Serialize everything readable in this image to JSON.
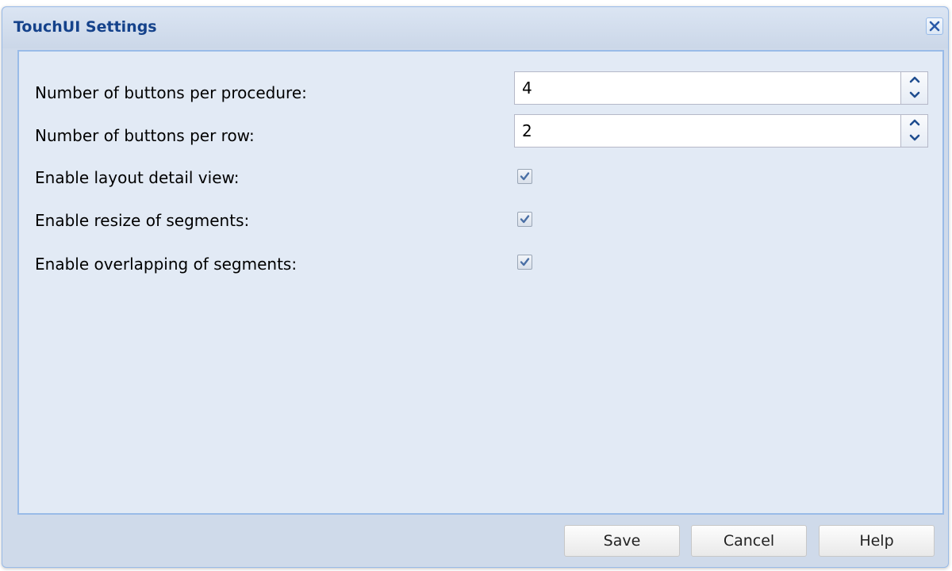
{
  "dialog": {
    "title": "TouchUI Settings",
    "close_icon": "close-icon"
  },
  "form": {
    "buttons_per_procedure": {
      "label": "Number of buttons per procedure:",
      "value": "4"
    },
    "buttons_per_row": {
      "label": "Number of buttons per row:",
      "value": "2"
    },
    "layout_detail_view": {
      "label": "Enable layout detail view:",
      "checked": true
    },
    "resize_segments": {
      "label": "Enable resize of segments:",
      "checked": true
    },
    "overlapping_segments": {
      "label": "Enable overlapping of segments:",
      "checked": true
    }
  },
  "footer": {
    "save_label": "Save",
    "cancel_label": "Cancel",
    "help_label": "Help"
  },
  "colors": {
    "title_text": "#15428b",
    "border_accent": "#99bbe8",
    "panel_background": "#e2eaf5",
    "frame_background": "#cfdaea",
    "spinner_arrow": "#1f4d8f",
    "checkmark": "#4a6fa5"
  }
}
